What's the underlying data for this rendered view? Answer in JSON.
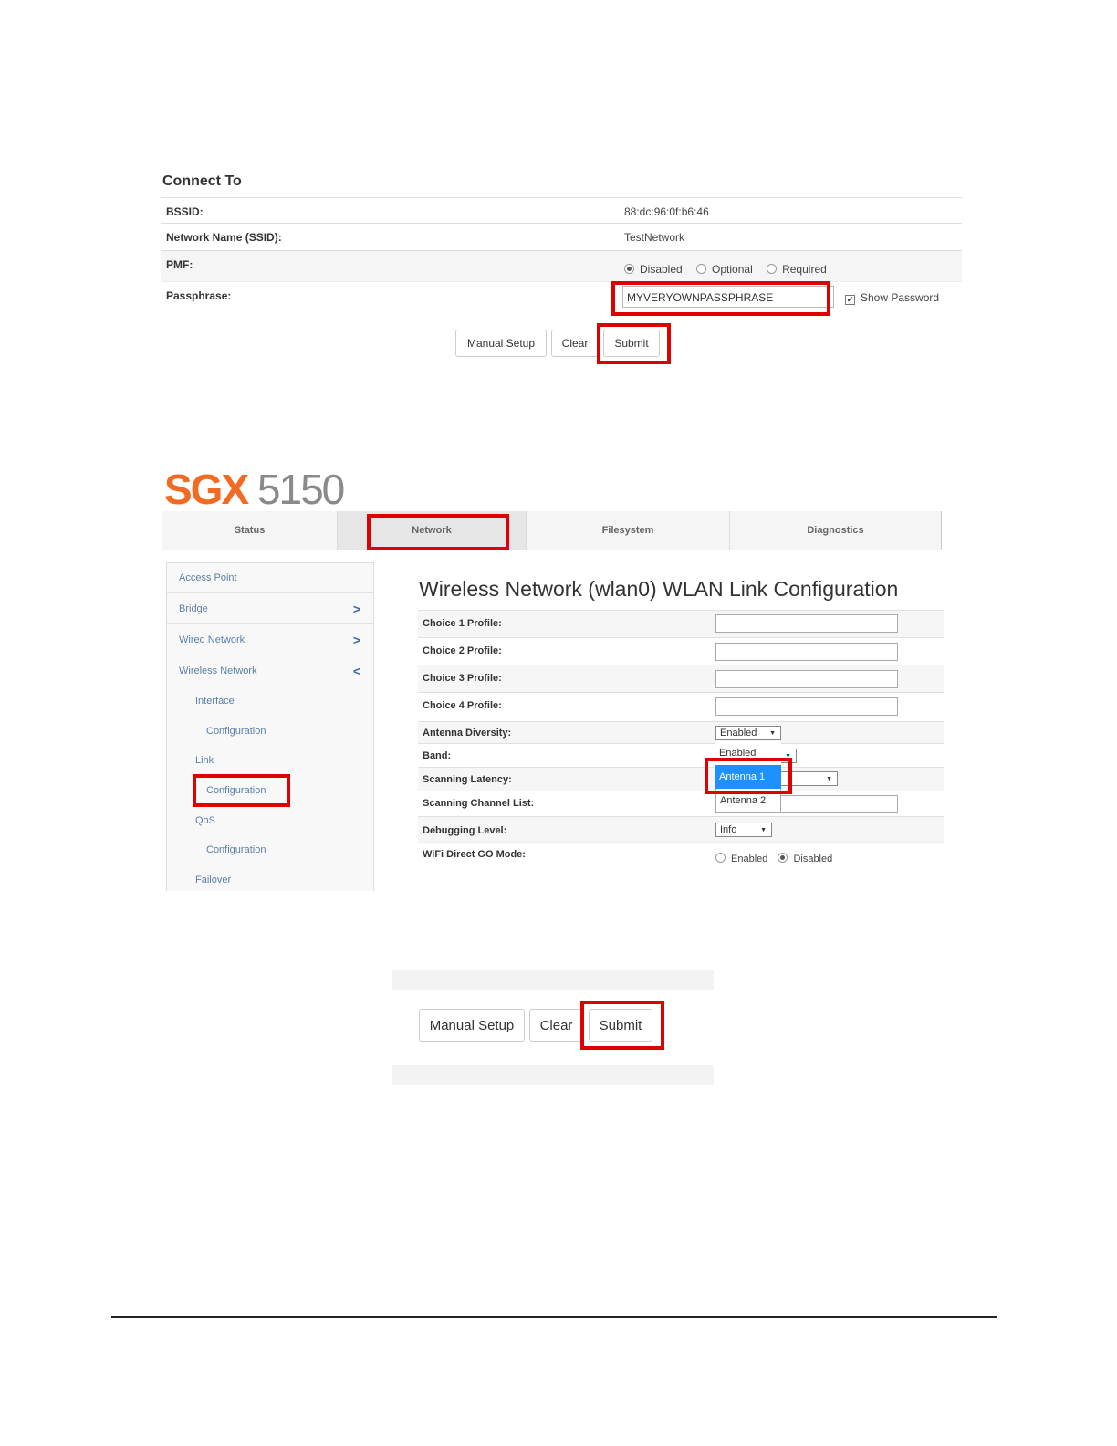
{
  "connect": {
    "heading": "Connect To",
    "bssid_label": "BSSID:",
    "bssid_value": "88:dc:96:0f:b6:46",
    "ssid_label": "Network Name (SSID):",
    "ssid_value": "TestNetwork",
    "pmf_label": "PMF:",
    "pmf_options": [
      "Disabled",
      "Optional",
      "Required"
    ],
    "pmf_selected": "Disabled",
    "passphrase_label": "Passphrase:",
    "passphrase_value": "MYVERYOWNPASSPHRASE",
    "show_password_label": "Show Password",
    "show_password_checked": true,
    "buttons": {
      "manual": "Manual Setup",
      "clear": "Clear",
      "submit": "Submit"
    }
  },
  "app": {
    "logo_brand": "SGX",
    "logo_model": " 5150",
    "logo_colors": {
      "brand": "#f26b22",
      "model": "#8a8a8a"
    },
    "tabs": [
      "Status",
      "Network",
      "Filesystem",
      "Diagnostics"
    ],
    "active_tab": "Network",
    "sidebar": {
      "access_point": "Access Point",
      "bridge": "Bridge",
      "wired": "Wired Network",
      "wireless": "Wireless Network",
      "interface": "Interface",
      "interface_config": "Configuration",
      "link": "Link",
      "link_config": "Configuration",
      "qos": "QoS",
      "qos_config": "Configuration",
      "failover": "Failover"
    },
    "title": "Wireless Network (wlan0) WLAN Link Configuration",
    "fields": {
      "choice1": "Choice 1 Profile:",
      "choice2": "Choice 2 Profile:",
      "choice3": "Choice 3 Profile:",
      "choice4": "Choice 4 Profile:",
      "antenna": "Antenna Diversity:",
      "band": "Band:",
      "scan_latency": "Scanning Latency:",
      "scan_channels": "Scanning Channel List:",
      "debug": "Debugging Level:",
      "wifi_direct": "WiFi Direct GO Mode:"
    },
    "antenna_value": "Enabled",
    "antenna_options": [
      "Enabled",
      "Antenna 1",
      "Antenna 2"
    ],
    "antenna_highlighted": "Antenna 1",
    "debug_value": "Info",
    "wifi_direct_options": [
      "Enabled",
      "Disabled"
    ],
    "wifi_direct_selected": "Disabled"
  },
  "bottom_buttons": {
    "manual": "Manual Setup",
    "clear": "Clear",
    "submit": "Submit"
  },
  "colors": {
    "highlight": "#e00000",
    "dropdown_selected": "#1e90ff"
  }
}
